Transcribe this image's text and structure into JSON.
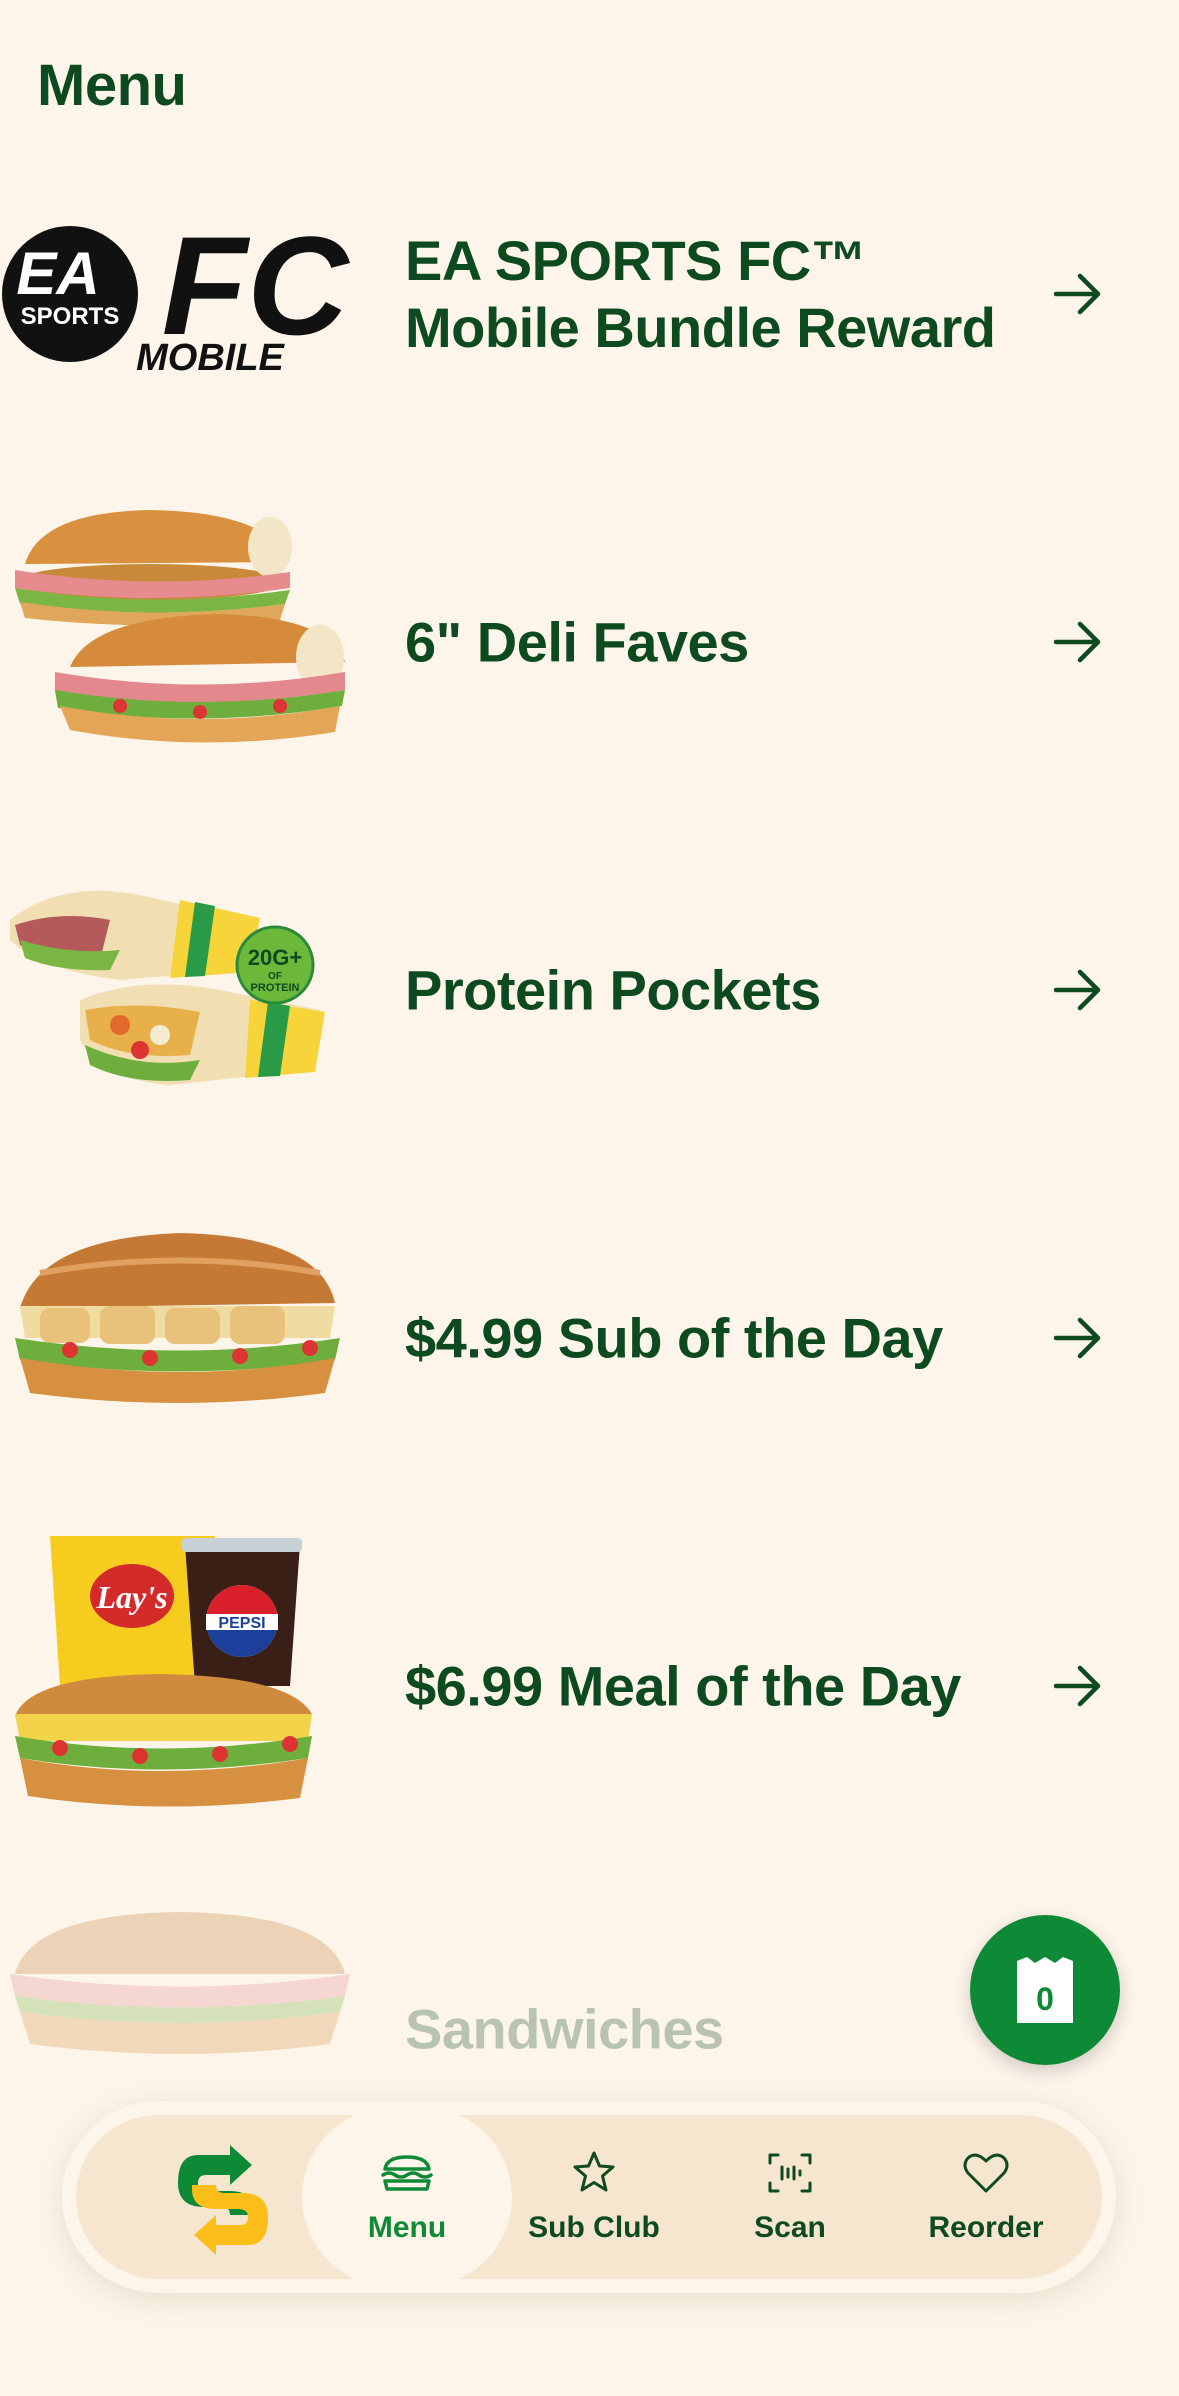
{
  "header": {
    "title": "Menu"
  },
  "menu_items": [
    {
      "label": "EA SPORTS FC™ Mobile Bundle Reward",
      "image": "ea-sports-fc-mobile-logo"
    },
    {
      "label": "6\" Deli Faves",
      "image": "deli-sandwiches-image"
    },
    {
      "label": "Protein Pockets",
      "image": "protein-pockets-image"
    },
    {
      "label": "$4.99 Sub of the Day",
      "image": "sub-of-the-day-image"
    },
    {
      "label": "$6.99 Meal of the Day",
      "image": "meal-of-the-day-image"
    },
    {
      "label": "Sandwiches",
      "image": "sandwiches-image"
    }
  ],
  "logo_text": {
    "ea": "EA",
    "sports": "SPORTS",
    "fc": "FC",
    "mobile": "MOBILE",
    "badge_number": "20G+",
    "badge_of": "OF",
    "badge_protein": "PROTEIN",
    "lays": "Lay's",
    "pepsi": "PEPSI"
  },
  "cart": {
    "count": "0",
    "icon": "shopping-bag-icon"
  },
  "bottom_nav": {
    "items": [
      {
        "label": "Menu",
        "icon": "sandwich-icon",
        "active": true
      },
      {
        "label": "Sub Club",
        "icon": "star-icon",
        "active": false
      },
      {
        "label": "Scan",
        "icon": "scan-icon",
        "active": false
      },
      {
        "label": "Reorder",
        "icon": "heart-icon",
        "active": false
      }
    ]
  },
  "colors": {
    "background": "#fdf5ea",
    "text_green": "#0d4a1f",
    "brand_green": "#0e8a36",
    "brand_yellow": "#fbbd18",
    "nav_background": "#f7e6cf"
  }
}
